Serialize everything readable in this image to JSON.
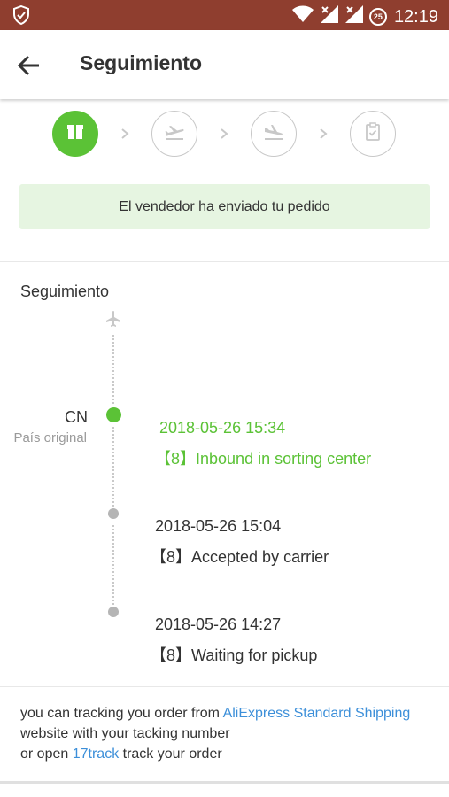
{
  "status_bar": {
    "time": "12:19",
    "notification_count": "25",
    "icons": [
      "shield-icon",
      "wifi-icon",
      "signal-icon",
      "signal-icon",
      "notification-badge"
    ]
  },
  "header": {
    "title": "Seguimiento",
    "back_icon": "arrow-left-icon"
  },
  "steps": [
    {
      "icon": "package-icon",
      "state": "active"
    },
    {
      "icon": "plane-takeoff-icon",
      "state": "pending"
    },
    {
      "icon": "plane-landing-icon",
      "state": "pending"
    },
    {
      "icon": "clipboard-check-icon",
      "state": "pending"
    }
  ],
  "banner": {
    "text": "El vendedor ha enviado tu pedido"
  },
  "tracking": {
    "title": "Seguimiento",
    "origin_code": "CN",
    "origin_label": "País original",
    "events": [
      {
        "time": "2018-05-26 15:34",
        "desc": "【8】Inbound in sorting center",
        "current": true
      },
      {
        "time": "2018-05-26 15:04",
        "desc": "【8】Accepted by carrier",
        "current": false
      },
      {
        "time": "2018-05-26 14:27",
        "desc": "【8】Waiting for pickup",
        "current": false
      }
    ]
  },
  "note": {
    "part1": "you can tracking you order from ",
    "link1": "AliExpress Standard Shipping",
    "part2": " website with your tacking number",
    "part3": "or open ",
    "link2": "17track",
    "part4": " track your order"
  },
  "colors": {
    "status_bar": "#8f3e2f",
    "accent_green": "#5bc236",
    "banner_bg": "#e6f5e1",
    "link": "#3c8fd9"
  }
}
